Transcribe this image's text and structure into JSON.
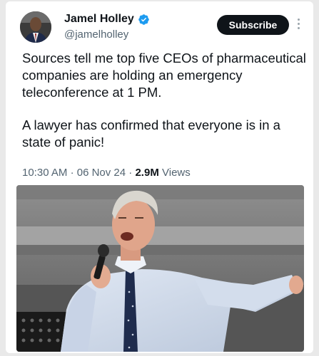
{
  "author": {
    "name": "Jamel Holley",
    "handle": "@jamelholley",
    "verified": true,
    "avatar_icon": "profile-avatar"
  },
  "actions": {
    "subscribe_label": "Subscribe",
    "more_icon": "vertical-ellipsis-icon"
  },
  "tweet": {
    "paragraph_1": "Sources tell me top five CEOs of pharmaceutical companies are holding an emergency teleconference at 1 PM.",
    "paragraph_2": "A lawyer has confirmed that everyone is in a state of panic!",
    "time": "10:30 AM",
    "date": "06 Nov 24",
    "views_count": "2.9M",
    "views_label": "Views",
    "separator": "·"
  },
  "colors": {
    "verified_blue": "#1d9bf0",
    "text_primary": "#0f1419",
    "text_secondary": "#536471",
    "button_bg": "#0f1419"
  }
}
